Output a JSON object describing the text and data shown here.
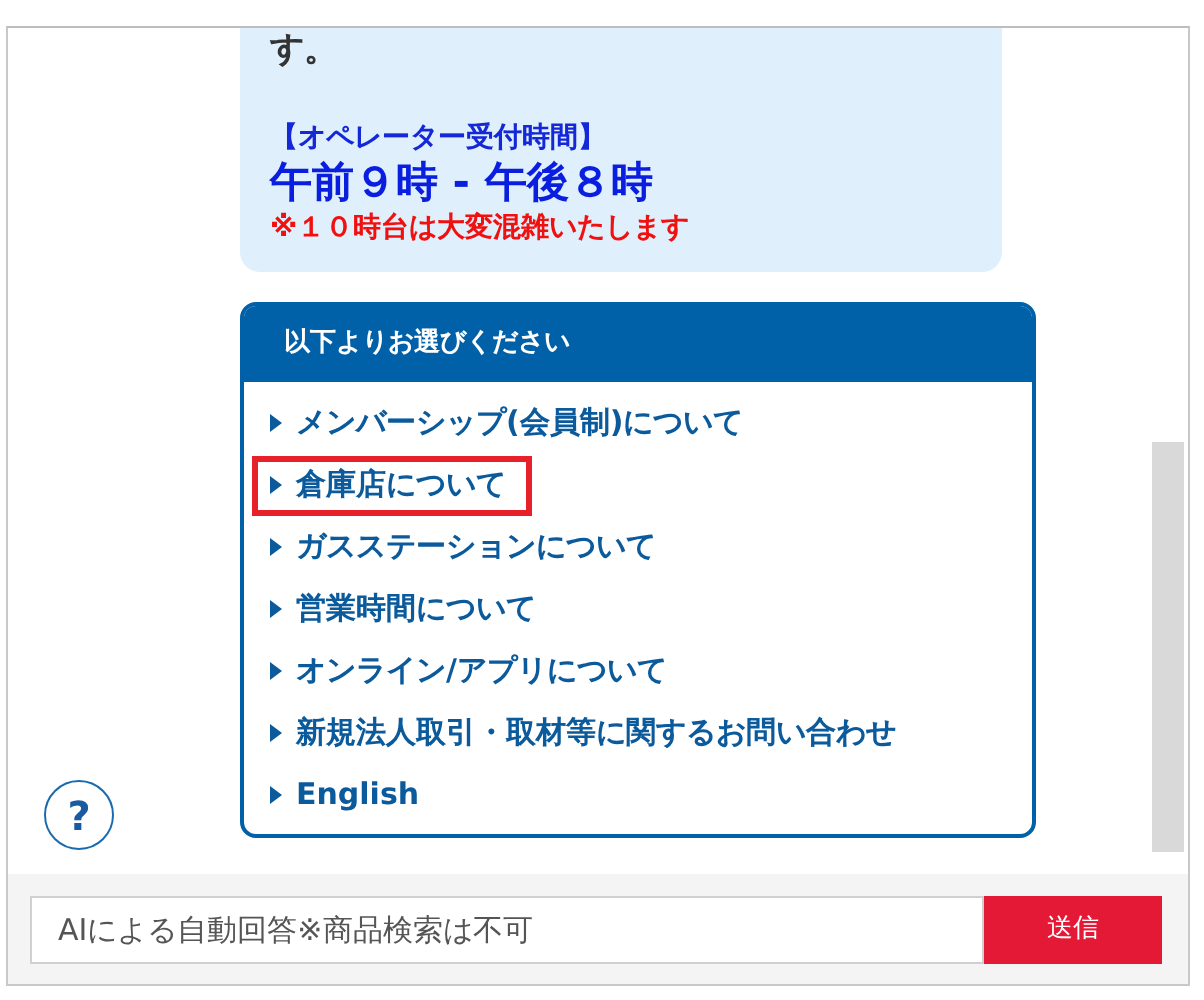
{
  "bubble": {
    "lead_text": "す。",
    "hours_label": "【オペレーター受付時間】",
    "hours": "午前９時 - 午後８時",
    "notice": "※１０時台は大変混雑いたします"
  },
  "menu": {
    "title": "以下よりお選びください",
    "items": [
      {
        "label": "メンバーシップ(会員制)について",
        "highlighted": false
      },
      {
        "label": "倉庫店について",
        "highlighted": true
      },
      {
        "label": "ガスステーションについて",
        "highlighted": false
      },
      {
        "label": "営業時間について",
        "highlighted": false
      },
      {
        "label": "オンライン/アプリについて",
        "highlighted": false
      },
      {
        "label": "新規法人取引・取材等に関するお問い合わせ",
        "highlighted": false
      },
      {
        "label": "English",
        "highlighted": false
      }
    ]
  },
  "help_button": {
    "label": "?"
  },
  "input": {
    "placeholder": "AIによる自動回答※商品検索は不可"
  },
  "send_button": {
    "label": "送信"
  }
}
